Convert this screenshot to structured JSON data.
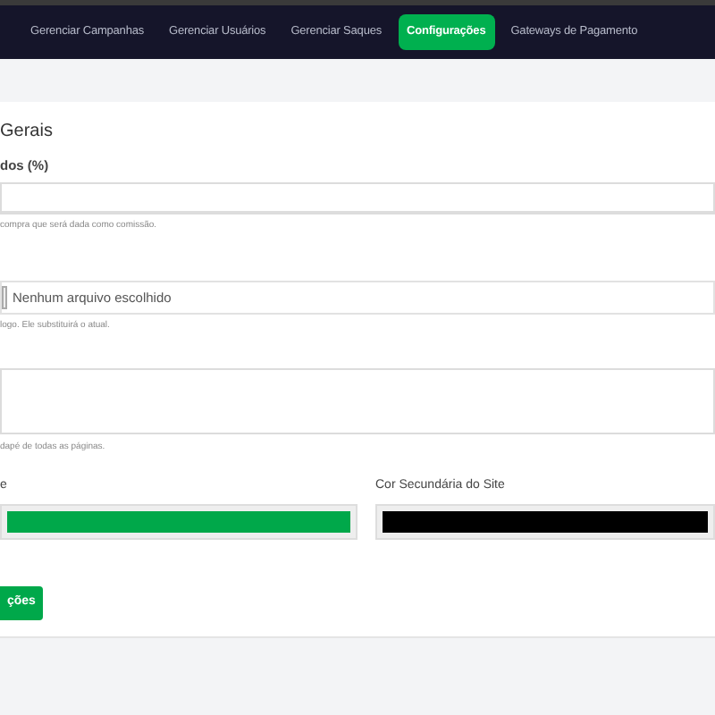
{
  "nav": [
    {
      "label": "Gerenciar Campanhas",
      "selected": false
    },
    {
      "label": "Gerenciar Usuários",
      "selected": false
    },
    {
      "label": "Gerenciar Saques",
      "selected": false
    },
    {
      "label": "Configurações",
      "selected": true
    },
    {
      "label": "Gateways de Pagamento",
      "selected": false
    }
  ],
  "section_title": "Gerais",
  "commission": {
    "label": "dos (%)",
    "help": "compra que será dada como comissão."
  },
  "logo": {
    "file_status": "Nenhum arquivo escolhido",
    "help": "logo. Ele substituirá o atual."
  },
  "footer": {
    "help": "dapé de todas as páginas."
  },
  "colors": [
    {
      "label": "e",
      "color": "#00a84a"
    },
    {
      "label": "Cor Secundária do Site",
      "color": "#000000"
    }
  ],
  "save_button": "ções"
}
